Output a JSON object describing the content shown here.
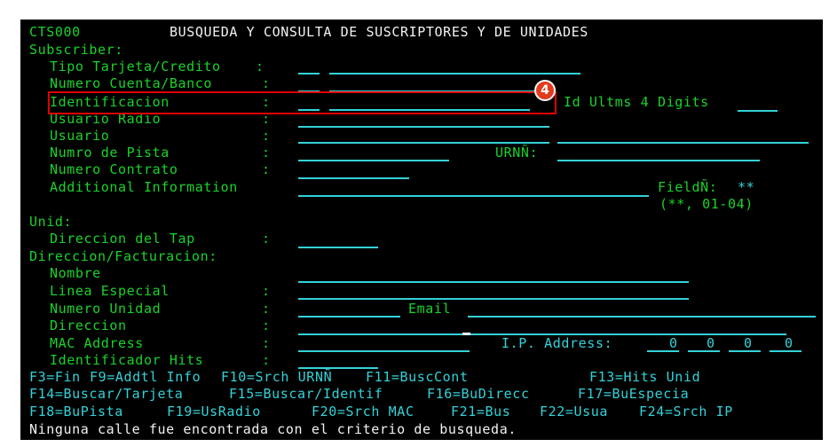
{
  "header": {
    "program_id": "CTS000",
    "title": "BUSQUEDA Y CONSULTA DE SUSCRIPTORES Y DE UNIDADES"
  },
  "subscriber": {
    "section_label": "Subscriber:",
    "tipo_tarjeta_label": "Tipo Tarjeta/Credito",
    "numero_cuenta_label": "Numero Cuenta/Banco",
    "identificacion_label": "Identificacion",
    "usuario_radio_label": "Usuario Radio",
    "usuario_label": "Usuario",
    "numro_pista_label": "Numro de Pista",
    "numero_contrato_label": "Numero Contrato",
    "additional_info_label": "Additional Information",
    "colon": ":",
    "id_ultms_label": "Id Ultms 4 Digits",
    "urn_label": "URNÑ:",
    "field_label": "FieldÑ:",
    "field_value": "**",
    "field_hint": "(**, 01-04)"
  },
  "unid": {
    "section_label": "Unid:",
    "direccion_tap_label": "Direccion del Tap"
  },
  "direccion_facturacion": {
    "section_label": "Direccion/Facturacion:",
    "nombre_label": "Nombre",
    "linea_especial_label": "Linea Especial",
    "numero_unidad_label": "Numero Unidad",
    "email_label": "Email",
    "direccion_label": "Direccion",
    "mac_address_label": "MAC Address",
    "ip_address_label": "I.P. Address:",
    "ip_octets": [
      "0",
      "0",
      "0",
      "0"
    ],
    "identificador_hits_label": "Identificador Hits"
  },
  "function_keys": {
    "row1": [
      "F3=Fin",
      "F9=Addtl Info",
      "F10=Srch URNÑ",
      "F11=BuscCont",
      "F13=Hits Unid"
    ],
    "row2": [
      "F14=Buscar/Tarjeta",
      "F15=Buscar/Identif",
      "F16=BuDirecc",
      "F17=BuEspecia"
    ],
    "row3": [
      "F18=BuPista",
      "F19=UsRadio",
      "F20=Srch MAC",
      "F21=Bus",
      "F22=Usua",
      "F24=Srch IP"
    ]
  },
  "status_message": "Ninguna calle fue encontrada con el criterio de busqueda.",
  "annotation": {
    "badge_number": "4",
    "color": "#e00000"
  }
}
